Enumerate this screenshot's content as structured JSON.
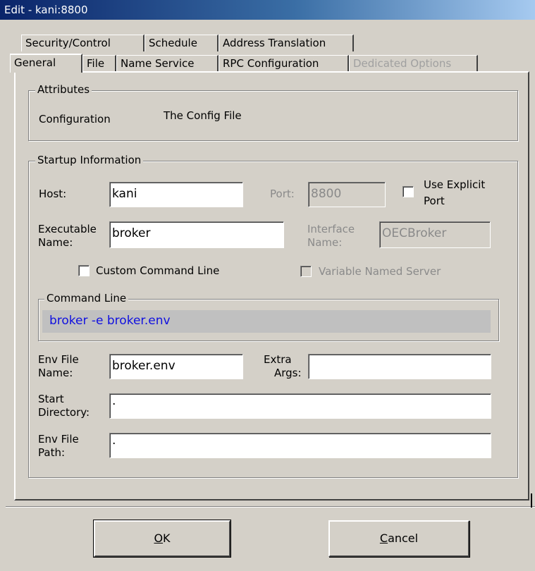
{
  "window": {
    "title": "Edit - kani:8800"
  },
  "tabs": {
    "row1": [
      {
        "label": "Security/Control"
      },
      {
        "label": "Schedule"
      },
      {
        "label": "Address Translation"
      }
    ],
    "row2": [
      {
        "label": "General"
      },
      {
        "label": "File"
      },
      {
        "label": "Name Service"
      },
      {
        "label": "RPC Configuration"
      },
      {
        "label": "Dedicated Options"
      }
    ]
  },
  "attributes": {
    "legend": "Attributes",
    "configuration_label": "Configuration",
    "configuration_value": "The Config File"
  },
  "startup": {
    "legend": "Startup Information",
    "host_label": "Host:",
    "host_value": "kani",
    "port_label": "Port:",
    "port_value": "8800",
    "use_explicit_port_line1": "Use Explicit",
    "use_explicit_port_line2": "Port",
    "executable_label_line1": "Executable",
    "executable_label_line2": "Name:",
    "executable_value": "broker",
    "interface_label_line1": "Interface",
    "interface_label_line2": "Name:",
    "interface_value": "OECBroker",
    "custom_command_line_label": "Custom Command Line",
    "variable_named_server_label": "Variable Named Server",
    "command_line_legend": "Command Line",
    "command_line_value": "broker -e broker.env",
    "env_file_name_label_line1": "Env File",
    "env_file_name_label_line2": "Name:",
    "env_file_name_value": "broker.env",
    "extra_args_label_line1": "Extra",
    "extra_args_label_line2": "Args:",
    "extra_args_value": "",
    "start_directory_label_line1": "Start",
    "start_directory_label_line2": "Directory:",
    "start_directory_value": ".",
    "env_file_path_label_line1": "Env File",
    "env_file_path_label_line2": "Path:",
    "env_file_path_value": "."
  },
  "buttons": {
    "ok_mnemonic": "O",
    "ok_rest": "K",
    "cancel_mnemonic": "C",
    "cancel_rest": "ancel"
  }
}
